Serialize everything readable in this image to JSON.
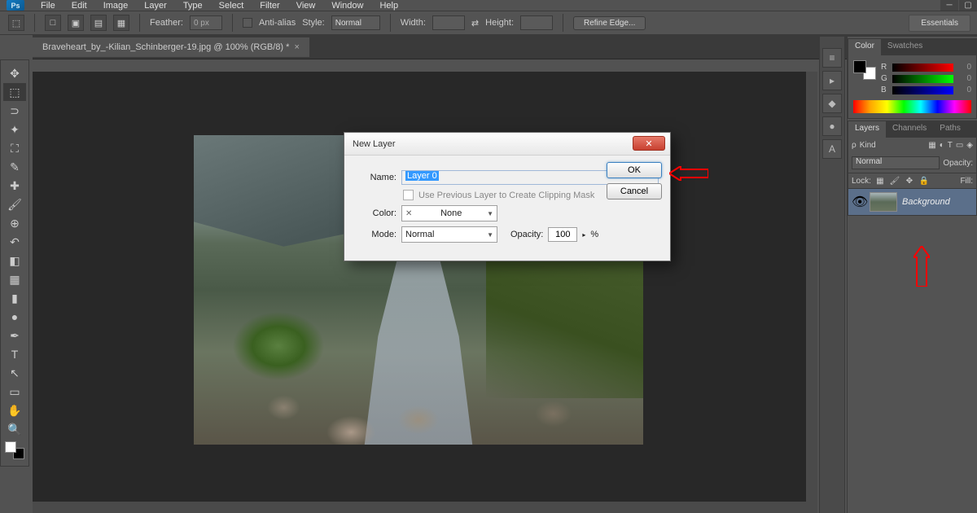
{
  "app": {
    "logo": "Ps"
  },
  "menu": [
    "File",
    "Edit",
    "Image",
    "Layer",
    "Type",
    "Select",
    "Filter",
    "View",
    "Window",
    "Help"
  ],
  "optbar": {
    "feather_label": "Feather:",
    "feather_value": "0 px",
    "antialias_label": "Anti-alias",
    "style_label": "Style:",
    "style_value": "Normal",
    "width_label": "Width:",
    "height_label": "Height:",
    "refine_label": "Refine Edge...",
    "workspace": "Essentials"
  },
  "tab": {
    "title": "Braveheart_by_-Kilian_Schinberger-19.jpg @ 100% (RGB/8) *"
  },
  "dialog": {
    "title": "New Layer",
    "name_label": "Name:",
    "name_value": "Layer 0",
    "clip_label": "Use Previous Layer to Create Clipping Mask",
    "color_label": "Color:",
    "color_value": "None",
    "mode_label": "Mode:",
    "mode_value": "Normal",
    "opacity_label": "Opacity:",
    "opacity_value": "100",
    "opacity_unit": "%",
    "ok": "OK",
    "cancel": "Cancel"
  },
  "panels": {
    "color": {
      "tab1": "Color",
      "tab2": "Swatches",
      "r": "R",
      "g": "G",
      "b": "B",
      "val": "0"
    },
    "layers": {
      "tab1": "Layers",
      "tab2": "Channels",
      "tab3": "Paths",
      "kind": "Kind",
      "blend": "Normal",
      "opacity_label": "Opacity:",
      "lock_label": "Lock:",
      "fill_label": "Fill:",
      "bg_layer": "Background"
    }
  }
}
